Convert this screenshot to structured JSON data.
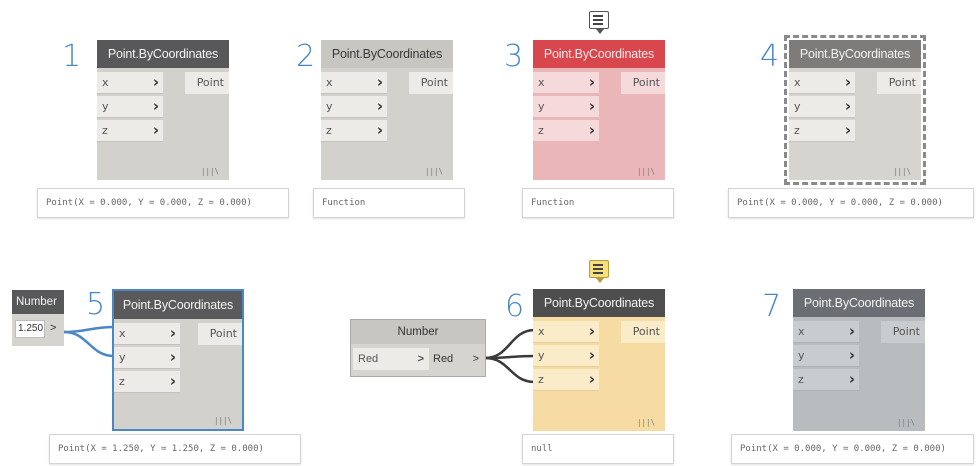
{
  "node_title": "Point.ByCoordinates",
  "inputs": [
    "x",
    "y",
    "z"
  ],
  "output": "Point",
  "lacing": "|||\\",
  "states": [
    {
      "number": "1",
      "preview": "Point(X = 0.000, Y = 0.000, Z = 0.000)"
    },
    {
      "number": "2",
      "preview": "Function"
    },
    {
      "number": "3",
      "preview": "Function"
    },
    {
      "number": "4",
      "preview": "Point(X = 0.000, Y = 0.000, Z = 0.000)"
    },
    {
      "number": "5",
      "preview": "Point(X = 1.250, Y = 1.250, Z = 0.000)"
    },
    {
      "number": "6",
      "preview": "null"
    },
    {
      "number": "7",
      "preview": "Point(X = 0.000, Y = 0.000, Z = 0.000)"
    }
  ],
  "number_node": {
    "title": "Number",
    "value": "1.250",
    "port": ">"
  },
  "number_node_6": {
    "title": "Number",
    "input_label": "Red",
    "input_arrow": ">",
    "output_label": "Red",
    "output_arrow": ">"
  },
  "colors": {
    "accent_blue": "#4a87c6",
    "error_red": "#d9474e",
    "warning_yellow": "#f6dca2",
    "frozen_gray": "#b8bcbf"
  }
}
